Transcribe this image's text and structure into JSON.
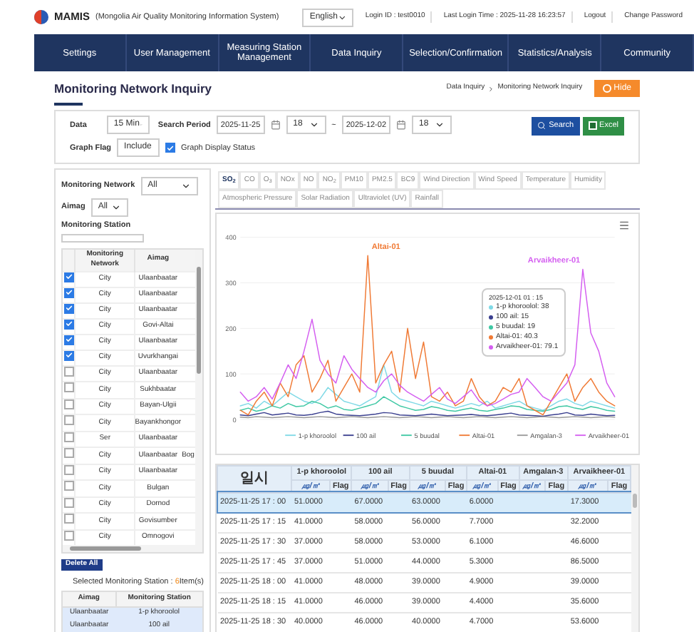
{
  "header": {
    "brand": "MAMIS",
    "subtitle": "(Mongolia Air Quality Monitoring Information System)",
    "language": "English",
    "login_id": "Login ID : test0010",
    "last_login": "Last Login Time : 2025-11-28 16:23:57",
    "links": [
      "Logout",
      "Change Password"
    ]
  },
  "nav": [
    "Settings",
    "User Management",
    "Measuring Station Management",
    "Data Inquiry",
    "Selection/Confirmation",
    "Statistics/Analysis",
    "Community"
  ],
  "page": {
    "title": "Monitoring Network Inquiry",
    "breadcrumb": [
      "Data Inquiry",
      "Monitoring Network Inquiry"
    ],
    "hide_button": "Hide"
  },
  "filters": {
    "data_label": "Data",
    "data_value": "15 Min",
    "period_label": "Search Period",
    "start_date": "2025-11-25",
    "start_hour": "18",
    "separator": "~",
    "end_date": "2025-12-02",
    "end_hour": "18",
    "search_button": "Search",
    "excel_button": "Excel",
    "flag_label": "Graph Flag",
    "flag_value": "Include",
    "display_label": "Graph Display Status",
    "display_checked": true
  },
  "left_panel": {
    "network_label": "Monitoring Network",
    "network_value": "All",
    "aimag_label": "Aimag",
    "aimag_value": "All",
    "station_label": "Monitoring Station",
    "list_columns": [
      "Monitoring Network",
      "Aimag"
    ],
    "list_rows": [
      {
        "checked": true,
        "network": "City",
        "aimag": "Ulaanbaatar"
      },
      {
        "checked": true,
        "network": "City",
        "aimag": "Ulaanbaatar"
      },
      {
        "checked": true,
        "network": "City",
        "aimag": "Ulaanbaatar"
      },
      {
        "checked": true,
        "network": "City",
        "aimag": "Govi-Altai"
      },
      {
        "checked": true,
        "network": "City",
        "aimag": "Ulaanbaatar"
      },
      {
        "checked": true,
        "network": "City",
        "aimag": "Uvurkhangai"
      },
      {
        "checked": false,
        "network": "City",
        "aimag": "Ulaanbaatar"
      },
      {
        "checked": false,
        "network": "City",
        "aimag": "Sukhbaatar"
      },
      {
        "checked": false,
        "network": "City",
        "aimag": "Bayan-Ulgii"
      },
      {
        "checked": false,
        "network": "City",
        "aimag": "Bayankhongor"
      },
      {
        "checked": false,
        "network": "Ser",
        "aimag": "Ulaanbaatar"
      },
      {
        "checked": false,
        "network": "City",
        "aimag": "Ulaanbaatar",
        "column_3": "Bog"
      },
      {
        "checked": false,
        "network": "City",
        "aimag": "Ulaanbaatar"
      },
      {
        "checked": false,
        "network": "City",
        "aimag": "Bulgan"
      },
      {
        "checked": false,
        "network": "City",
        "aimag": "Dornod"
      },
      {
        "checked": false,
        "network": "City",
        "aimag": "Govisumber"
      },
      {
        "checked": false,
        "network": "City",
        "aimag": "Omnogovi"
      }
    ],
    "delete_button": "Delete All",
    "selected_label": "Selected Monitoring Station : ",
    "selected_count": "6",
    "selected_suffix": "Item(s)",
    "selected_columns": [
      "Aimag",
      "Monitoring Station"
    ],
    "selected_rows": [
      {
        "aimag": "Ulaanbaatar",
        "station": "1-p khoroolol"
      },
      {
        "aimag": "Ulaanbaatar",
        "station": "100 ail"
      }
    ]
  },
  "tabs": [
    {
      "label": "SO$_{2}$",
      "selected": true
    },
    {
      "label": "CO",
      "selected": false
    },
    {
      "label": "O$_{3}$",
      "selected": false
    },
    {
      "label": "NOx",
      "selected": false
    },
    {
      "label": "NO",
      "selected": false
    },
    {
      "label": "NO$_{2}$",
      "selected": false
    },
    {
      "label": "PM10",
      "selected": false
    },
    {
      "label": "PM2.5",
      "selected": false
    },
    {
      "label": "BC9",
      "selected": false
    },
    {
      "label": "Wind Direction",
      "selected": false
    },
    {
      "label": "Wind Speed",
      "selected": false
    },
    {
      "label": "Temperature",
      "selected": false
    },
    {
      "label": "Humidity",
      "selected": false
    },
    {
      "label": "Atmospheric Pressure",
      "selected": false
    },
    {
      "label": "Solar Radiation",
      "selected": false
    },
    {
      "label": "Ultraviolet (UV)",
      "selected": false
    },
    {
      "label": "Rainfall",
      "selected": false
    }
  ],
  "chart": {
    "chart_data": {
      "type": "line",
      "ylim": [
        0,
        400
      ],
      "yticks": [
        0,
        100,
        200,
        300,
        400
      ],
      "series": [
        {
          "name": "1-p khoroolol",
          "color": "#7fd9e6",
          "values": [
            30,
            35,
            25,
            40,
            30,
            45,
            60,
            50,
            40,
            35,
            45,
            70,
            55,
            40,
            35,
            30,
            40,
            50,
            120,
            60,
            45,
            40,
            35,
            30,
            40,
            35,
            30,
            25,
            30,
            35,
            30,
            40,
            25,
            30,
            35,
            40,
            30,
            25,
            20,
            30,
            40,
            45,
            35,
            30,
            40,
            35,
            30,
            25
          ]
        },
        {
          "name": "100 ail",
          "color": "#3a3f8f",
          "values": [
            10,
            8,
            12,
            15,
            10,
            12,
            14,
            10,
            9,
            11,
            15,
            18,
            12,
            10,
            9,
            8,
            10,
            12,
            15,
            14,
            10,
            9,
            8,
            10,
            12,
            10,
            8,
            9,
            10,
            11,
            9,
            8,
            10,
            12,
            14,
            10,
            9,
            8,
            7,
            10,
            12,
            15,
            10,
            9,
            12,
            10,
            8,
            9
          ]
        },
        {
          "name": "5 buudal",
          "color": "#3fc8a4",
          "values": [
            20,
            25,
            18,
            22,
            30,
            25,
            35,
            28,
            30,
            40,
            35,
            25,
            30,
            22,
            20,
            25,
            30,
            35,
            50,
            40,
            30,
            25,
            20,
            22,
            28,
            25,
            20,
            18,
            22,
            25,
            20,
            18,
            22,
            25,
            30,
            28,
            22,
            20,
            18,
            22,
            28,
            30,
            25,
            22,
            28,
            25,
            20,
            18
          ]
        },
        {
          "name": "Altai-01",
          "color": "#f07a35",
          "values": [
            20,
            10,
            40,
            60,
            30,
            80,
            50,
            120,
            140,
            60,
            90,
            130,
            40,
            70,
            100,
            60,
            360,
            80,
            120,
            150,
            60,
            200,
            90,
            170,
            50,
            40,
            60,
            30,
            40,
            90,
            50,
            30,
            40,
            70,
            60,
            90,
            30,
            20,
            10,
            40,
            70,
            100,
            40,
            70,
            90,
            60,
            40,
            30
          ]
        },
        {
          "name": "Amgalan-3",
          "color": "#9a9a9a",
          "values": [
            5,
            4,
            6,
            5,
            4,
            5,
            6,
            5,
            4,
            5,
            6,
            5,
            4,
            5,
            6,
            5,
            4,
            5,
            6,
            5,
            4,
            5,
            6,
            5,
            4,
            5,
            6,
            5,
            4,
            5,
            6,
            5,
            4,
            5,
            6,
            5,
            4,
            5,
            6,
            5,
            4,
            5,
            6,
            5,
            4,
            5,
            6,
            5
          ]
        },
        {
          "name": "Arvaikheer-01",
          "color": "#d45ef0",
          "values": [
            60,
            40,
            50,
            70,
            45,
            80,
            120,
            90,
            150,
            220,
            130,
            100,
            80,
            140,
            110,
            90,
            70,
            60,
            85,
            100,
            75,
            60,
            50,
            40,
            55,
            70,
            45,
            35,
            50,
            65,
            40,
            30,
            35,
            45,
            55,
            60,
            90,
            70,
            50,
            40,
            60,
            80,
            120,
            330,
            190,
            150,
            80,
            50
          ]
        }
      ],
      "grid": true,
      "legend": "bottom"
    },
    "peak_labels": [
      {
        "text": "Altai-01",
        "color": "#f07a35"
      },
      {
        "text": "Arvaikheer-01",
        "color": "#d45ef0"
      }
    ],
    "tooltip": {
      "title": "2025-12-01 01 : 15",
      "items": [
        {
          "text": "1-p khoroolol: 38",
          "color": "#7fd9e6"
        },
        {
          "text": "100 ail: 15",
          "color": "#3a3f8f"
        },
        {
          "text": "5 buudal: 19",
          "color": "#3fc8a4"
        },
        {
          "text": "Altai-01: 40.3",
          "color": "#f07a35"
        },
        {
          "text": "Arvaikheer-01: 79.1",
          "color": "#d45ef0"
        }
      ]
    }
  },
  "table": {
    "time_header": "일시",
    "stations": [
      {
        "name": "1-p khoroolol",
        "unit": "㎍/㎥",
        "flag": "Flag"
      },
      {
        "name": "100 ail",
        "unit": "㎍/㎥",
        "flag": "Flag"
      },
      {
        "name": "5 buudal",
        "unit": "㎍/㎥",
        "flag": "Flag"
      },
      {
        "name": "Altai-01",
        "unit": "㎍/㎥",
        "flag": "Flag"
      },
      {
        "name": "Amgalan-3",
        "unit": "㎍/㎥",
        "flag": "Flag"
      },
      {
        "name": "Arvaikheer-01",
        "unit": "㎍/㎥",
        "flag": "Flag"
      }
    ],
    "rows": [
      {
        "time": "2025-11-25 17 : 00",
        "selected": true,
        "readings": [
          {
            "kind": "value",
            "value": "51.0000"
          },
          {
            "kind": "value",
            "value": "67.0000"
          },
          {
            "kind": "value",
            "value": "63.0000"
          },
          {
            "kind": "value",
            "value": "6.0000"
          },
          {
            "kind": "blank"
          },
          {
            "kind": "value",
            "value": "17.3000"
          }
        ]
      },
      {
        "time": "2025-11-25 17 : 15",
        "selected": false,
        "readings": [
          {
            "kind": "value",
            "value": "41.0000"
          },
          {
            "kind": "value",
            "value": "58.0000"
          },
          {
            "kind": "value",
            "value": "56.0000"
          },
          {
            "kind": "value",
            "value": "7.7000"
          },
          {
            "kind": "blank"
          },
          {
            "kind": "value",
            "value": "32.2000"
          }
        ]
      },
      {
        "time": "2025-11-25 17 : 30",
        "selected": false,
        "readings": [
          {
            "kind": "value",
            "value": "37.0000"
          },
          {
            "kind": "value",
            "value": "58.0000"
          },
          {
            "kind": "value",
            "value": "53.0000"
          },
          {
            "kind": "value",
            "value": "6.1000"
          },
          {
            "kind": "blank"
          },
          {
            "kind": "value",
            "value": "46.6000"
          }
        ]
      },
      {
        "time": "2025-11-25 17 : 45",
        "selected": false,
        "readings": [
          {
            "kind": "value",
            "value": "37.0000"
          },
          {
            "kind": "value",
            "value": "51.0000"
          },
          {
            "kind": "value",
            "value": "44.0000"
          },
          {
            "kind": "value",
            "value": "5.3000"
          },
          {
            "kind": "blank"
          },
          {
            "kind": "value",
            "value": "86.5000"
          }
        ]
      },
      {
        "time": "2025-11-25 18 : 00",
        "selected": false,
        "readings": [
          {
            "kind": "value",
            "value": "41.0000"
          },
          {
            "kind": "value",
            "value": "48.0000"
          },
          {
            "kind": "value",
            "value": "39.0000"
          },
          {
            "kind": "value",
            "value": "4.9000"
          },
          {
            "kind": "blank"
          },
          {
            "kind": "value",
            "value": "39.0000"
          }
        ]
      },
      {
        "time": "2025-11-25 18 : 15",
        "selected": false,
        "readings": [
          {
            "kind": "value",
            "value": "41.0000"
          },
          {
            "kind": "value",
            "value": "46.0000"
          },
          {
            "kind": "value",
            "value": "39.0000"
          },
          {
            "kind": "value",
            "value": "4.4000"
          },
          {
            "kind": "blank"
          },
          {
            "kind": "value",
            "value": "35.6000"
          }
        ]
      },
      {
        "time": "2025-11-25 18 : 30",
        "selected": false,
        "readings": [
          {
            "kind": "value",
            "value": "40.0000"
          },
          {
            "kind": "value",
            "value": "46.0000"
          },
          {
            "kind": "value",
            "value": "40.0000"
          },
          {
            "kind": "value",
            "value": "4.7000"
          },
          {
            "kind": "blank"
          },
          {
            "kind": "value",
            "value": "53.6000"
          }
        ]
      }
    ]
  }
}
